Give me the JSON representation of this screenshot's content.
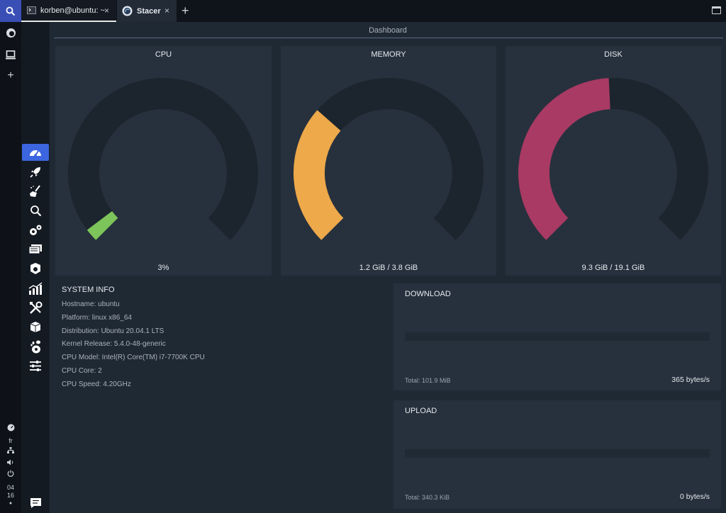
{
  "window": {
    "tabs": [
      {
        "label": "korben@ubuntu: ~",
        "icon": "terminal-icon"
      },
      {
        "label": "Stacer",
        "icon": "stacer-logo-icon"
      }
    ],
    "close_symbol": "×",
    "add_tab_symbol": "+"
  },
  "dock": {
    "keyboard_layout": "fr",
    "clock_hour": "04",
    "clock_minute": "16"
  },
  "app": {
    "page_title": "Dashboard",
    "nav_icons": [
      "dashboard-icon",
      "startup-apps-icon",
      "system-cleaner-icon",
      "search-icon",
      "services-icon",
      "processes-icon",
      "uninstaller-icon",
      "resources-icon",
      "helpers-icon",
      "apt-repository-icon",
      "gnome-settings-icon",
      "settings-icon"
    ],
    "feedback_icon": "feedback-icon"
  },
  "gauges": [
    {
      "title": "CPU",
      "value_text": "3%",
      "fraction": 0.03,
      "color": "#7dc45a"
    },
    {
      "title": "MEMORY",
      "value_text": "1.2 GiB / 3.8 GiB",
      "fraction": 0.32,
      "color": "#eea94a"
    },
    {
      "title": "DISK",
      "value_text": "9.3 GiB / 19.1 GiB",
      "fraction": 0.49,
      "color": "#a83a64"
    }
  ],
  "system_info": {
    "title": "SYSTEM INFO",
    "rows": [
      "Hostname: ubuntu",
      "Platform: linux x86_64",
      "Distribution: Ubuntu 20.04.1 LTS",
      "Kernel Release: 5.4.0-48-generic",
      "CPU Model: Intel(R) Core(TM) i7-7700K CPU",
      "CPU Core: 2",
      "CPU Speed: 4.20GHz"
    ]
  },
  "network": {
    "download": {
      "title": "DOWNLOAD",
      "total": "Total: 101.9 MiB",
      "rate": "365 bytes/s"
    },
    "upload": {
      "title": "UPLOAD",
      "total": "Total: 340.3 KiB",
      "rate": "0 bytes/s"
    }
  },
  "colors": {
    "accent": "#3c65e0",
    "gauge_track": "#1c242e",
    "panel": "#27313d"
  }
}
